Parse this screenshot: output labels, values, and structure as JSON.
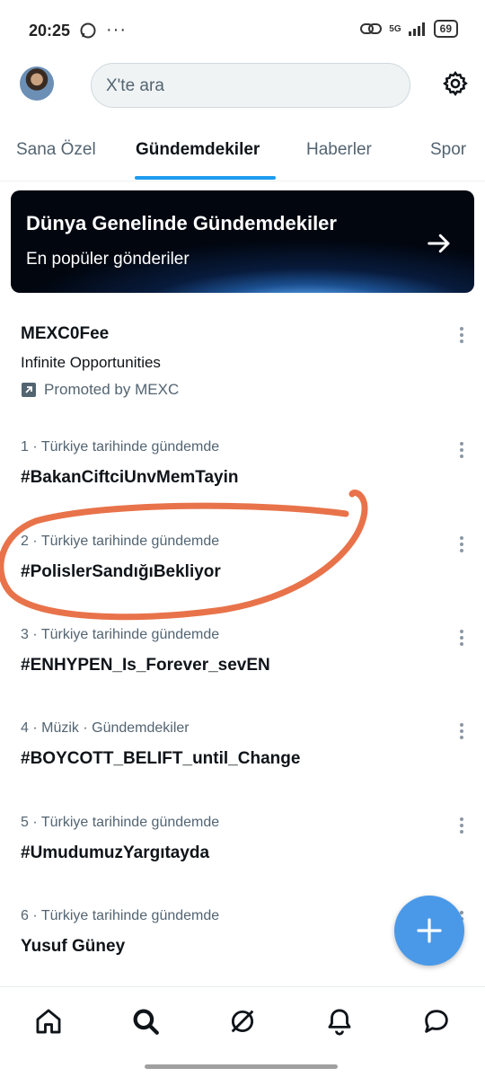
{
  "status_bar": {
    "time": "20:25",
    "dots": "···",
    "network": "5G",
    "battery": "69"
  },
  "header": {
    "search_placeholder": "X'te ara"
  },
  "tabs": [
    {
      "label": "Sana Özel",
      "active": false
    },
    {
      "label": "Gündemdekiler",
      "active": true
    },
    {
      "label": "Haberler",
      "active": false
    },
    {
      "label": "Spor",
      "active": false
    }
  ],
  "banner": {
    "title": "Dünya Genelinde Gündemdekiler",
    "subtitle": "En popüler gönderiler"
  },
  "promoted": {
    "title": "MEXC0Fee",
    "subtitle": "Infinite Opportunities",
    "promo_text": "Promoted by MEXC"
  },
  "trends": [
    {
      "meta": "1 · Türkiye tarihinde gündemde",
      "title": "#BakanCiftciUnvMemTayin"
    },
    {
      "meta": "2 · Türkiye tarihinde gündemde",
      "title": "#PolislerSandığıBekliyor"
    },
    {
      "meta": "3 · Türkiye tarihinde gündemde",
      "title": "#ENHYPEN_Is_Forever_sevEN"
    },
    {
      "meta": "4 · Müzik · Gündemdekiler",
      "title": "#BOYCOTT_BELIFT_until_Change"
    },
    {
      "meta": "5 · Türkiye tarihinde gündemde",
      "title": "#UmudumuzYargıtayda"
    },
    {
      "meta": "6 · Türkiye tarihinde gündemde",
      "title": "Yusuf Güney"
    }
  ],
  "colors": {
    "accent": "#1d9bf0",
    "fab": "#4a99e9",
    "annotation": "#e8734a"
  },
  "icons": [
    "home-icon",
    "search-icon",
    "grok-icon",
    "bell-icon",
    "message-icon",
    "gear-icon",
    "plus-icon"
  ]
}
